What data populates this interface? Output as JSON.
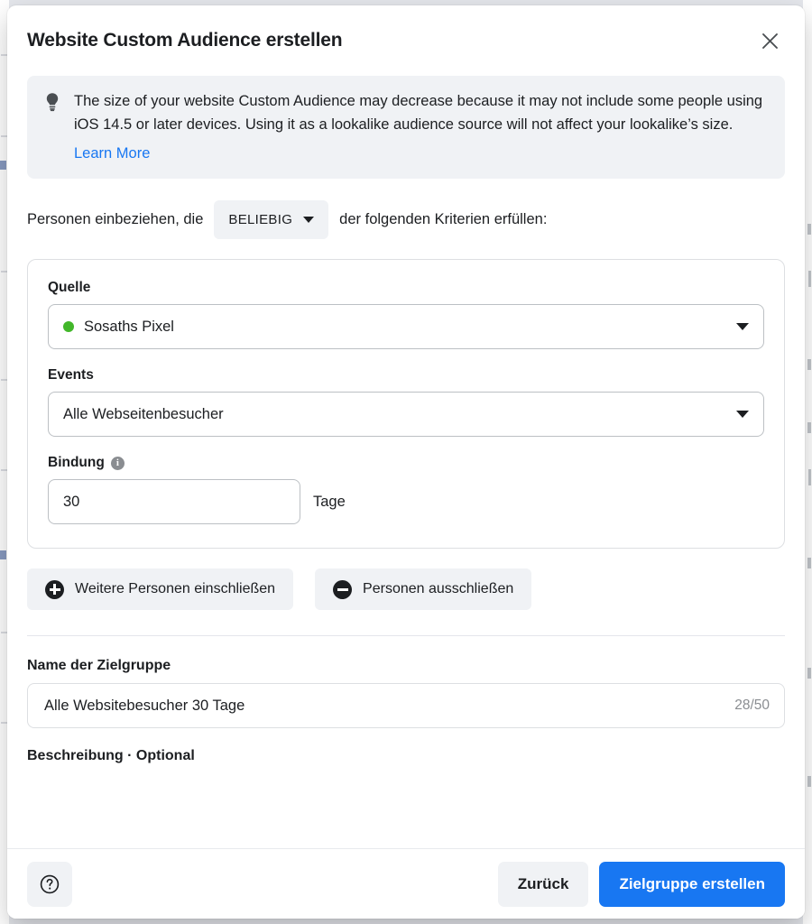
{
  "colors": {
    "accent_blue": "#1877F2",
    "link_blue": "#1877F2",
    "pixel_status_green": "#42B72A",
    "surface_grey": "#F0F2F5",
    "text_primary": "#1C1E21",
    "text_muted": "#8A8D91",
    "border": "#BCC0C4"
  },
  "header": {
    "title": "Website Custom Audience erstellen",
    "close_icon": "close-icon",
    "close_label": "✕"
  },
  "notice": {
    "icon": "lightbulb-icon",
    "text": "The size of your website Custom Audience may decrease because it may not include some people using iOS 14.5 or later devices. Using it as a lookalike audience source will not affect your lookalike’s size.",
    "link_label": "Learn More"
  },
  "criteria": {
    "prefix_text": "Personen einbeziehen, die",
    "match_selector": {
      "value": "BELIEBIG",
      "caret_icon": "chevron-down-icon"
    },
    "suffix_text": "der folgenden Kriterien erfüllen:"
  },
  "rule_card": {
    "source": {
      "label": "Quelle",
      "value": "Sosaths Pixel",
      "status_icon": "status-dot-icon",
      "caret_icon": "chevron-down-icon"
    },
    "events": {
      "label": "Events",
      "value": "Alle Webseitenbesucher",
      "caret_icon": "chevron-down-icon"
    },
    "retention": {
      "label": "Bindung",
      "info_icon": "info-icon",
      "info_glyph": "i",
      "value": "30",
      "placeholder": "30",
      "unit": "Tage"
    }
  },
  "rule_actions": {
    "include": {
      "label": "Weitere Personen einschließen",
      "icon": "plus-circle-icon"
    },
    "exclude": {
      "label": "Personen ausschließen",
      "icon": "minus-circle-icon"
    }
  },
  "audience": {
    "name_label": "Name der Zielgruppe",
    "name_value": "Alle Websitebesucher 30 Tage",
    "name_placeholder": "Name der Zielgruppe",
    "char_count": "28/50",
    "description_label": "Beschreibung · Optional"
  },
  "footer": {
    "help_icon": "question-circle-icon",
    "help_glyph": "?",
    "back_label": "Zurück",
    "submit_label": "Zielgruppe erstellen"
  }
}
